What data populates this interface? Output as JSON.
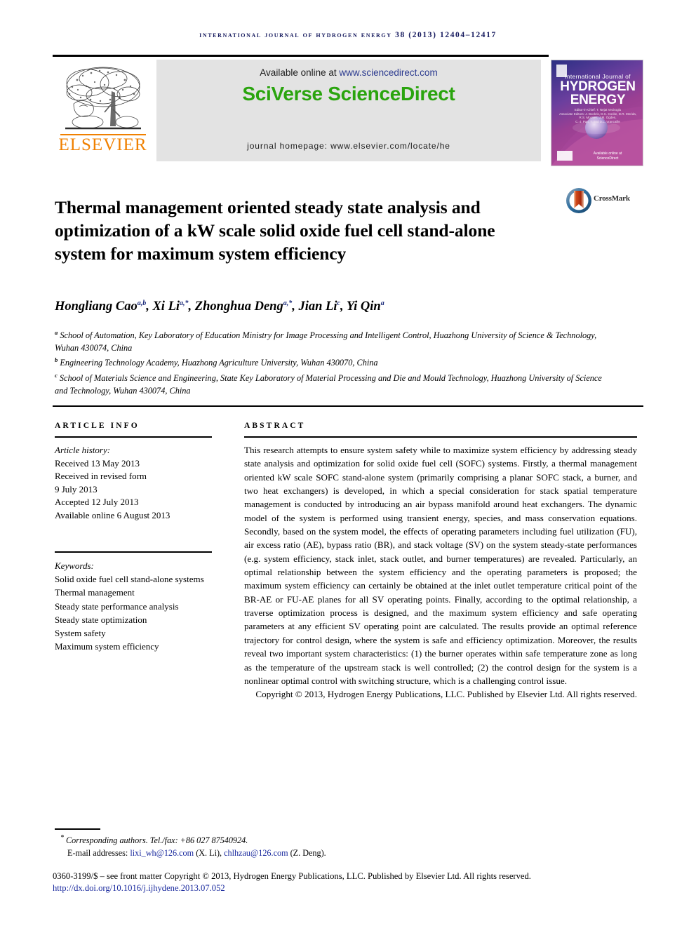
{
  "running_head": "International Journal of Hydrogen Energy 38 (2013) 12404–12417",
  "banner": {
    "publisher_name": "ELSEVIER",
    "publisher_logo_alt": "elsevier-tree-logo",
    "available_prefix": "Available online at ",
    "available_url": "www.sciencedirect.com",
    "platform_name": "SciVerse ScienceDirect",
    "homepage_line": "journal homepage: www.elsevier.com/locate/he",
    "cover": {
      "line_small": "International Journal of",
      "line1": "HYDROGEN",
      "line2": "ENERGY",
      "editors": "Editor-in-Chief: T. Nejat Veziroglu\nAssociate Editors: J. Bockris, D.C. Cocke, D.R. Merida,\nR.S. Morales, J.M. Ogden,\nC.-J. Pan, T. and D.L. Vrancaille",
      "bottom_text": "Available online at\nScienceDirect"
    }
  },
  "title": "Thermal management oriented steady state analysis and optimization of a kW scale solid oxide fuel cell stand-alone system for maximum system efficiency",
  "crossmark": {
    "label": "CrossMark",
    "icon": "crossmark-icon"
  },
  "authors": [
    {
      "name": "Hongliang Cao",
      "sup": "a,b",
      "sep": ", "
    },
    {
      "name": "Xi Li",
      "sup": "a,*",
      "sep": ", "
    },
    {
      "name": "Zhonghua Deng",
      "sup": "a,*",
      "sep": ", "
    },
    {
      "name": "Jian Li",
      "sup": "c",
      "sep": ", "
    },
    {
      "name": "Yi Qin",
      "sup": "a",
      "sep": ""
    }
  ],
  "affiliations": [
    {
      "mark": "a",
      "text": "School of Automation, Key Laboratory of Education Ministry for Image Processing and Intelligent Control, Huazhong University of Science & Technology, Wuhan 430074, China"
    },
    {
      "mark": "b",
      "text": "Engineering Technology Academy, Huazhong Agriculture University, Wuhan 430070, China"
    },
    {
      "mark": "c",
      "text": "School of Materials Science and Engineering, State Key Laboratory of Material Processing and Die and Mould Technology, Huazhong University of Science and Technology, Wuhan 430074, China"
    }
  ],
  "article_info": {
    "heading": "ARTICLE INFO",
    "history_label": "Article history:",
    "history": [
      "Received 13 May 2013",
      "Received in revised form",
      "9 July 2013",
      "Accepted 12 July 2013",
      "Available online 6 August 2013"
    ],
    "keywords_label": "Keywords:",
    "keywords": [
      "Solid oxide fuel cell stand-alone systems",
      "Thermal management",
      "Steady state performance analysis",
      "Steady state optimization",
      "System safety",
      "Maximum system efficiency"
    ]
  },
  "abstract": {
    "heading": "ABSTRACT",
    "body": "This research attempts to ensure system safety while to maximize system efficiency by addressing steady state analysis and optimization for solid oxide fuel cell (SOFC) systems. Firstly, a thermal management oriented kW scale SOFC stand-alone system (primarily comprising a planar SOFC stack, a burner, and two heat exchangers) is developed, in which a special consideration for stack spatial temperature management is conducted by introducing an air bypass manifold around heat exchangers. The dynamic model of the system is performed using transient energy, species, and mass conservation equations. Secondly, based on the system model, the effects of operating parameters including fuel utilization (FU), air excess ratio (AE), bypass ratio (BR), and stack voltage (SV) on the system steady-state performances (e.g. system efficiency, stack inlet, stack outlet, and burner temperatures) are revealed. Particularly, an optimal relationship between the system efficiency and the operating parameters is proposed; the maximum system efficiency can certainly be obtained at the inlet outlet temperature critical point of the BR-AE or FU-AE planes for all SV operating points. Finally, according to the optimal relationship, a traverse optimization process is designed, and the maximum system efficiency and safe operating parameters at any efficient SV operating point are calculated. The results provide an optimal reference trajectory for control design, where the system is safe and efficiency optimization. Moreover, the results reveal two important system characteristics: (1) the burner operates within safe temperature zone as long as the temperature of the upstream stack is well controlled; (2) the control design for the system is a nonlinear optimal control with switching structure, which is a challenging control issue.",
    "copyright": "Copyright © 2013, Hydrogen Energy Publications, LLC. Published by Elsevier Ltd. All rights reserved."
  },
  "footer": {
    "corresponding": "Corresponding authors. Tel./fax: +86 027 87540924.",
    "email_label": "E-mail addresses: ",
    "email1": "lixi_wh@126.com",
    "email1_owner": " (X. Li), ",
    "email2": "chlhzau@126.com",
    "email2_owner": " (Z. Deng).",
    "front_matter": "0360-3199/$ – see front matter Copyright © 2013, Hydrogen Energy Publications, LLC. Published by Elsevier Ltd. All rights reserved.",
    "doi": "http://dx.doi.org/10.1016/j.ijhydene.2013.07.052"
  },
  "colors": {
    "running_head": "#161a5e",
    "sciverse_green": "#2aa40e",
    "elsevier_orange": "#f08000",
    "link_blue": "#1a2a9e",
    "banner_grey": "#e3e3e3"
  }
}
